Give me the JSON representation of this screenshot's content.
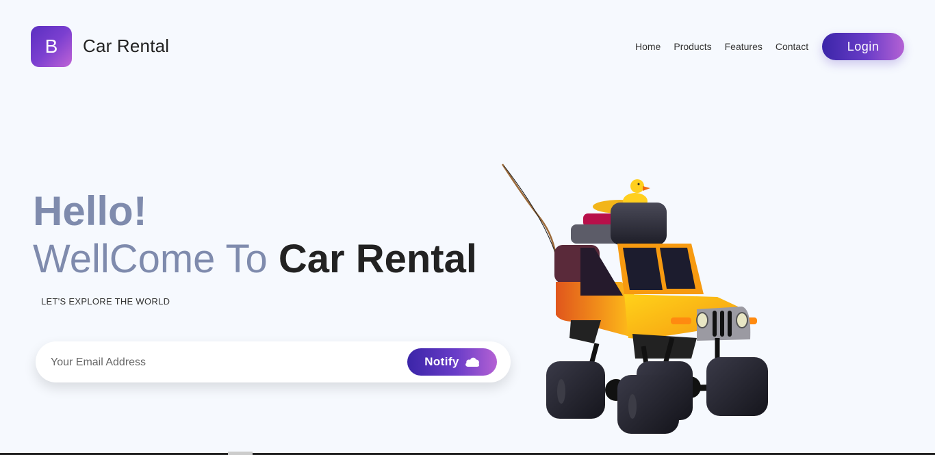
{
  "brand": {
    "logo_letter": "B",
    "name": "Car Rental"
  },
  "nav": {
    "items": [
      "Home",
      "Products",
      "Features",
      "Contact"
    ],
    "login_label": "Login"
  },
  "hero": {
    "hello": "Hello!",
    "welcome_prefix": "WellCome To ",
    "welcome_highlight": "Car Rental",
    "tagline": "LET'S EXPLORE THE WORLD"
  },
  "signup": {
    "email_placeholder": "Your Email Address",
    "email_value": "",
    "notify_label": "Notify",
    "notify_icon": "cloud-icon"
  },
  "colors": {
    "accent_start": "#3b25a8",
    "accent_end": "#b461d4",
    "muted_heading": "#7f8bad",
    "background": "#f6f9fe"
  }
}
